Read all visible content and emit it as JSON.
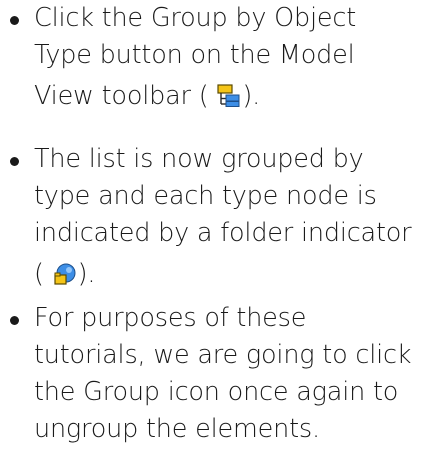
{
  "instructions": [
    {
      "lines": [
        "Click the Group by Object",
        "Type button on the Model"
      ],
      "last_line_before": "View toolbar ( ",
      "last_line_after": ").",
      "icon": "group-by-type-icon"
    },
    {
      "lines": [
        "The list is now grouped by",
        "type and each type node is",
        "indicated by a folder indicator"
      ],
      "last_line_before": "( ",
      "last_line_after": ").",
      "icon": "folder-indicator-icon"
    },
    {
      "lines": [
        "For purposes of these",
        "tutorials, we are going to click",
        "the Group icon once again to",
        "ungroup the elements."
      ]
    }
  ],
  "colors": {
    "text": "#1a1a1a",
    "icon_yellow": "#f5c518",
    "icon_blue": "#3d8ee6"
  }
}
